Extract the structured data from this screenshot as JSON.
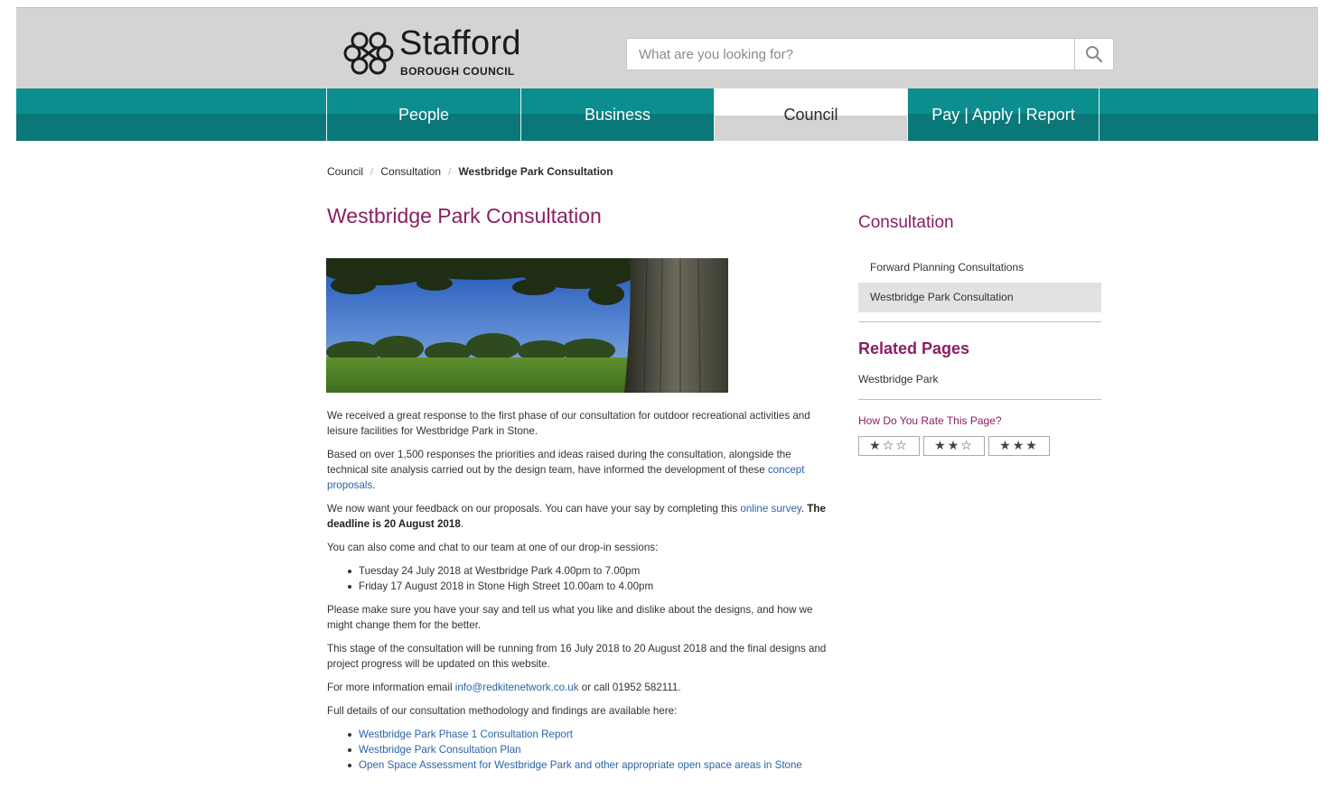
{
  "header": {
    "logo_name": "Stafford",
    "logo_sub": "BOROUGH COUNCIL",
    "search_placeholder": "What are you looking for?",
    "search_icon": "search-icon"
  },
  "nav": {
    "items": [
      {
        "label": "People"
      },
      {
        "label": "Business"
      },
      {
        "label": "Council"
      },
      {
        "label": "Pay | Apply | Report"
      }
    ],
    "active": "Council"
  },
  "breadcrumb": {
    "items": [
      "Council",
      "Consultation",
      "Westbridge Park Consultation"
    ],
    "separator": "/"
  },
  "main": {
    "title": "Westbridge Park Consultation",
    "p1": "We received a great response to the first phase of our consultation for outdoor recreational activities and leisure facilities for Westbridge Park in Stone.",
    "p2_text": "Based on over 1,500 responses the priorities and ideas raised during the consultation, alongside the technical site analysis carried out by the design team, have informed the development of these ",
    "p2_link": "concept proposals",
    "p2_end": ".",
    "p3_text": "We now want your feedback on our proposals. You can have your say by completing this ",
    "p3_link": "online survey",
    "p3_mid": ". ",
    "p3_bold": "The deadline is 20 August 2018",
    "p3_end": ".",
    "p4": "You can also come and chat to our team at one of our drop-in sessions:",
    "sessions": [
      "Tuesday 24 July 2018 at Westbridge Park 4.00pm to 7.00pm",
      "Friday 17 August 2018 in Stone High Street 10.00am to 4.00pm"
    ],
    "p5": "Please make sure you have your say and tell us what you like and dislike about the designs, and how we might change them for the better.",
    "p6": "This stage of the consultation will be running from 16 July 2018 to 20 August 2018 and the final designs and project progress will be updated on this website.",
    "p7_text": "For more information email ",
    "p7_link": "info@redkitenetwork.co.uk",
    "p7_end": " or call 01952 582111.",
    "p8": "Full details of our consultation methodology and findings are available here:",
    "documents": [
      "Westbridge Park Phase 1 Consultation Report",
      "Westbridge Park Consultation Plan",
      "Open Space Assessment for Westbridge Park and other appropriate open space areas in Stone"
    ]
  },
  "sidebar": {
    "heading": "Consultation",
    "links": [
      "Forward Planning Consultations",
      "Westbridge Park Consultation"
    ],
    "active_link": "Westbridge Park Consultation",
    "related_heading": "Related Pages",
    "related_links": [
      "Westbridge Park"
    ],
    "rate_heading": "How Do You Rate This Page?",
    "ratings": [
      "★☆☆",
      "★★☆",
      "★★★"
    ]
  },
  "colors": {
    "brand_purple": "#8a1f63",
    "nav_teal": "#0c8e8f",
    "link_blue": "#2a64a8",
    "header_grey": "#d6d4d2"
  }
}
